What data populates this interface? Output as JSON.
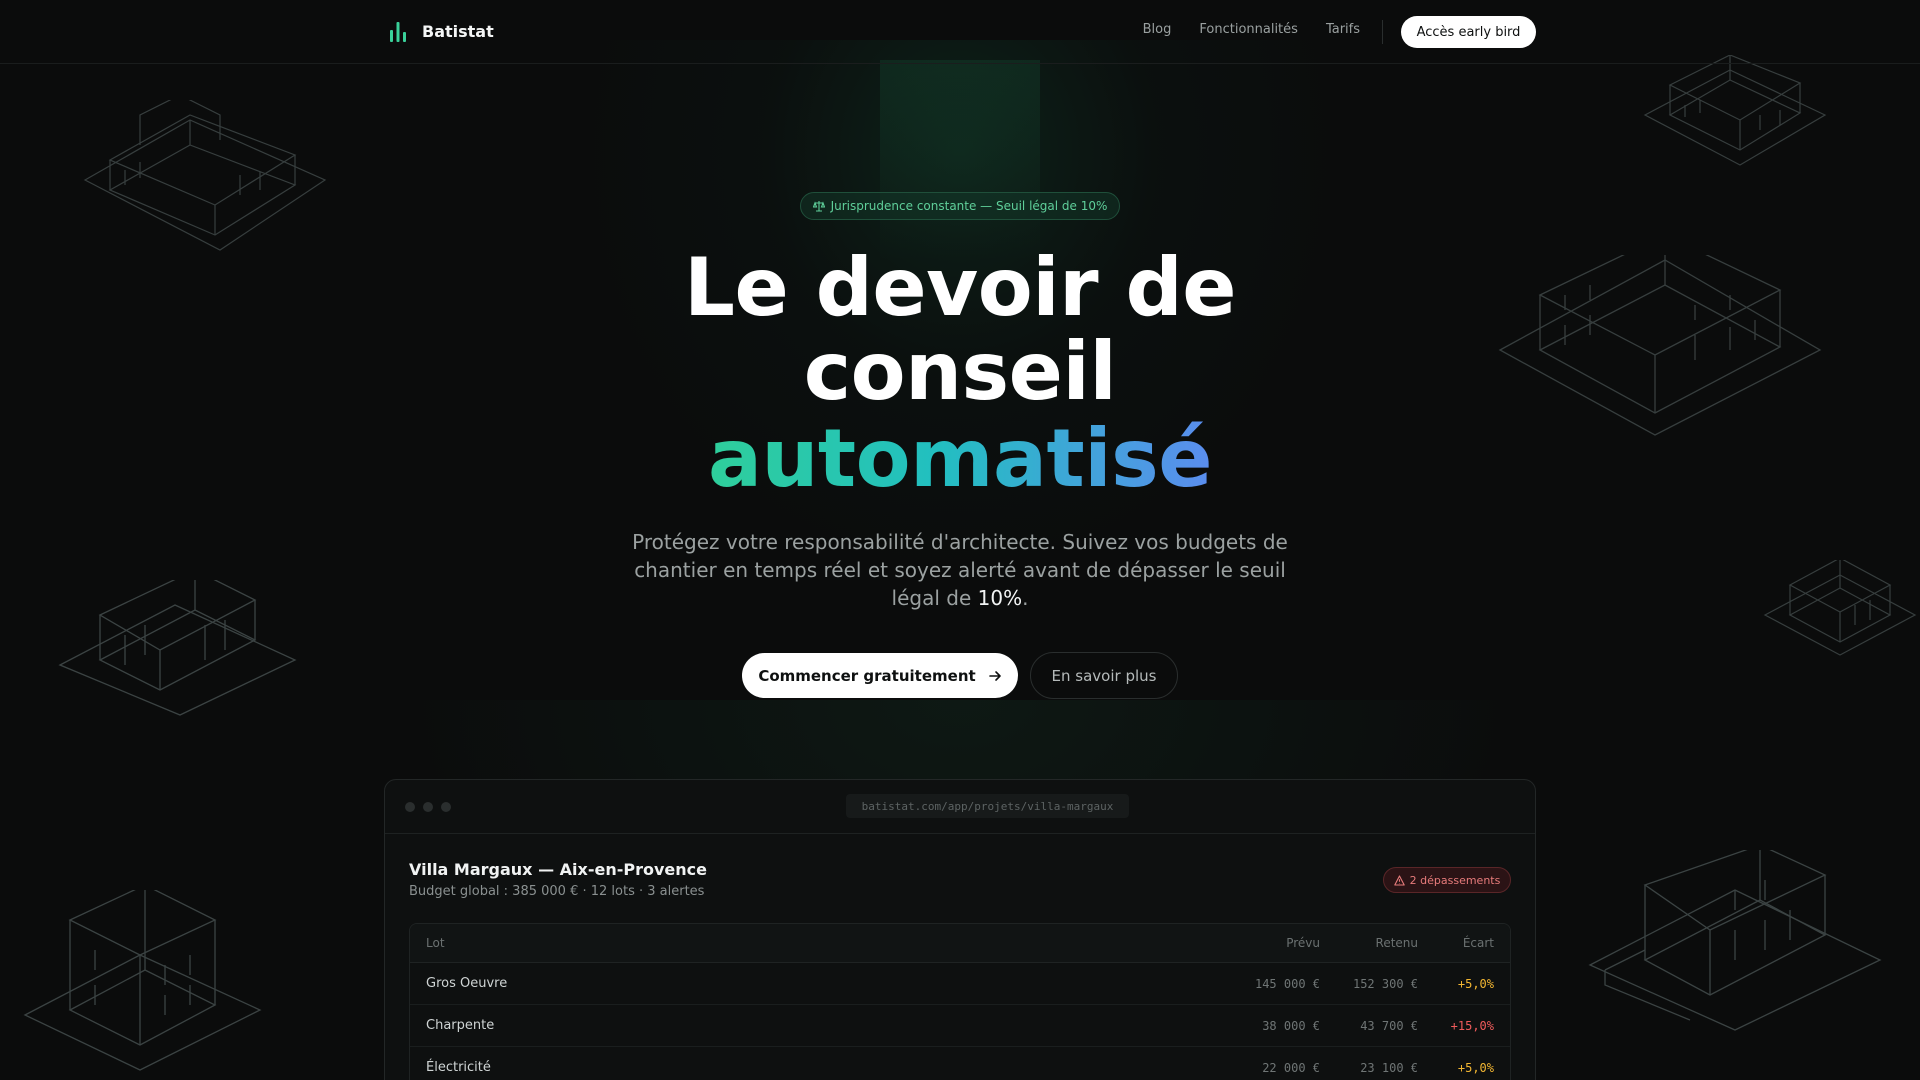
{
  "brand": {
    "name": "Batistat"
  },
  "nav": {
    "links": [
      "Blog",
      "Fonctionnalités",
      "Tarifs"
    ],
    "cta": "Accès early bird"
  },
  "hero": {
    "badge": "Jurisprudence constante — Seuil légal de 10%",
    "title_line1": "Le devoir de",
    "title_line2": "conseil",
    "title_highlight": "automatisé",
    "lede_part1": "Protégez votre responsabilité d'architecte. Suivez vos budgets de chantier en temps réel et soyez alerté avant de dépasser le seuil légal de ",
    "lede_strong": "10%",
    "lede_end": ".",
    "primary_cta": "Commencer gratuitement",
    "secondary_cta": "En savoir plus"
  },
  "app": {
    "url": "batistat.com/app/projets/villa-margaux",
    "project_title": "Villa Margaux — Aix-en-Provence",
    "project_sub": "Budget global : 385 000 € · 12 lots · 3 alertes",
    "alert_badge": "2 dépassements",
    "columns": [
      "Lot",
      "Prévu",
      "Retenu",
      "Écart"
    ],
    "rows": [
      {
        "lot": "Gros Oeuvre",
        "prevu": "145 000 €",
        "retenu": "152 300 €",
        "ecart": "+5,0%",
        "level": "warn"
      },
      {
        "lot": "Charpente",
        "prevu": "38 000 €",
        "retenu": "43 700 €",
        "ecart": "+15,0%",
        "level": "crit"
      },
      {
        "lot": "Électricité",
        "prevu": "22 000 €",
        "retenu": "23 100 €",
        "ecart": "+5,0%",
        "level": "warn"
      }
    ]
  },
  "colors": {
    "accent_green": "#2fcf9b",
    "accent_blue": "#5b8def",
    "warning": "#f2b632",
    "danger": "#ef5b5b"
  },
  "icons": [
    "bar-chart-logo-icon",
    "scales-icon",
    "arrow-right-icon",
    "warning-triangle-icon",
    "house-wireframe-icon"
  ]
}
